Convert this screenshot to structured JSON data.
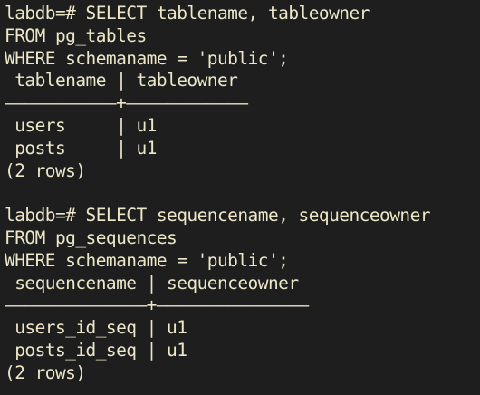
{
  "terminal": {
    "lines": [
      "labdb=# SELECT tablename, tableowner",
      "FROM pg_tables",
      "WHERE schemaname = 'public';",
      " tablename | tableowner",
      "———————————+————————————",
      " users     | u1",
      " posts     | u1",
      "(2 rows)",
      "",
      "labdb=# SELECT sequencename, sequenceowner",
      "FROM pg_sequences",
      "WHERE schemaname = 'public';",
      " sequencename | sequenceowner",
      "——————————————+———————————————",
      " users_id_seq | u1",
      " posts_id_seq | u1",
      "(2 rows)"
    ]
  },
  "colors": {
    "background": "#1e1e1e",
    "foreground": "#ede6c8"
  }
}
